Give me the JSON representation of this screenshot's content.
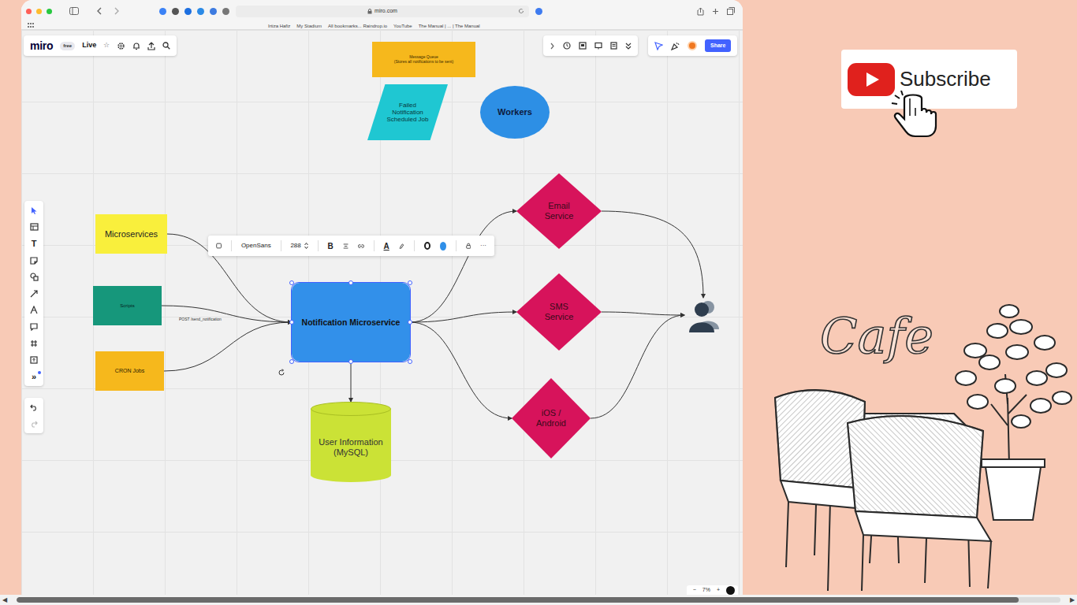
{
  "browser": {
    "address": "miro.com",
    "bookmarks": [
      "Irtiza Hafiz",
      "My Stadium",
      "All bookmarks... Raindrop.io",
      "YouTube",
      "The Manual | ... | The Manual"
    ]
  },
  "miro": {
    "logo": "miro",
    "plan": "free",
    "board": "Live",
    "star": "☆",
    "share": "Share"
  },
  "left_toolbar": {
    "text_tool": "T",
    "more": "»"
  },
  "format_toolbar": {
    "font": "OpenSans",
    "size": "288",
    "bold": "B",
    "text_color": "A",
    "fill_color": "#2f8fe8",
    "more": "···"
  },
  "diagram": {
    "nodes": [
      {
        "label": "Message Queue\n(Stores all notifications to be sent)",
        "kind": "rect",
        "color": "#f6b81c",
        "selected": false
      },
      {
        "label": "Failed Notification Scheduled Job",
        "kind": "parallelogram",
        "color": "#1fc7d2",
        "selected": false
      },
      {
        "label": "Workers",
        "kind": "ellipse",
        "color": "#2d8fe5",
        "selected": false
      },
      {
        "label": "Microservices",
        "kind": "rect",
        "color": "#f9ef3c",
        "selected": false
      },
      {
        "label": "Scripts",
        "kind": "rect",
        "color": "#16977b",
        "selected": false
      },
      {
        "label": "CRON Jobs",
        "kind": "rect",
        "color": "#f6b81c",
        "selected": false
      },
      {
        "label": "Notification Microservice",
        "kind": "rounded",
        "color": "#3290ea",
        "selected": true
      },
      {
        "label": "User Information (MySQL)",
        "kind": "cylinder",
        "color": "#cbe236",
        "selected": false
      },
      {
        "label": "Email Service",
        "kind": "diamond",
        "color": "#d7135b",
        "selected": false
      },
      {
        "label": "SMS Service",
        "kind": "diamond",
        "color": "#d7135b",
        "selected": false
      },
      {
        "label": "iOS / Android",
        "kind": "diamond",
        "color": "#d7135b",
        "selected": false
      },
      {
        "kind": "person",
        "color": "#2f3e4f",
        "selected": false
      }
    ],
    "edge_label": "POST /send_notification"
  },
  "zoom": {
    "out": "−",
    "level": "7%",
    "in": "+"
  },
  "promo": {
    "subscribe": "Subscribe",
    "cafe": "Cafe"
  },
  "scrollbar": {
    "left": "◀",
    "right": "▶",
    "level": 0.96
  }
}
